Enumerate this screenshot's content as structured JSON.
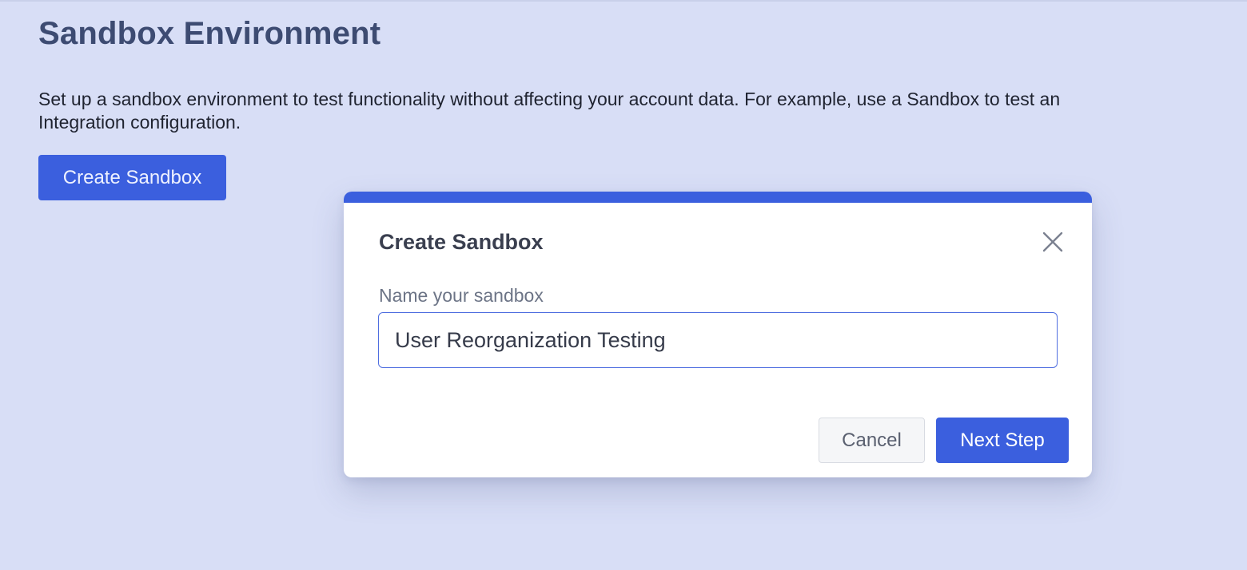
{
  "page": {
    "title": "Sandbox Environment",
    "description": "Set up a sandbox environment to test functionality without affecting your account data. For example, use a Sandbox to test an Integration configuration.",
    "create_button_label": "Create Sandbox"
  },
  "modal": {
    "title": "Create Sandbox",
    "close_icon": "close-icon",
    "field_label": "Name your sandbox",
    "name_value": "User Reorganization Testing",
    "cancel_label": "Cancel",
    "next_label": "Next Step"
  },
  "colors": {
    "background": "#d8def6",
    "accent": "#3b5fde",
    "title_text": "#3d4b72",
    "input_border": "#4f6ee0"
  }
}
